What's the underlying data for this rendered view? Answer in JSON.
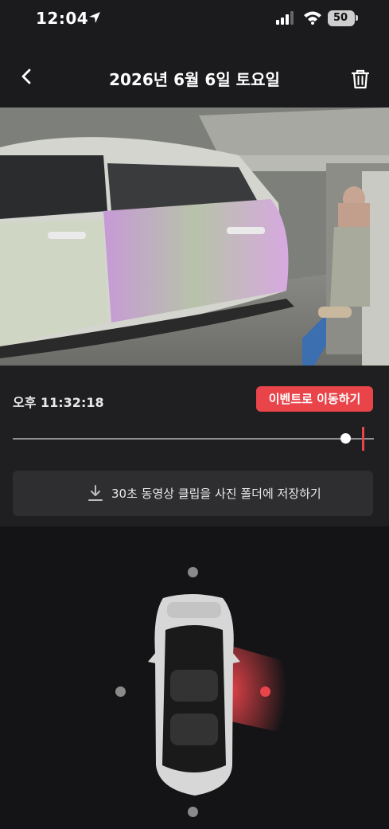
{
  "status_bar": {
    "time": "12:04",
    "battery": "50",
    "icons": [
      "location-arrow-icon",
      "cellular-signal-icon",
      "wifi-icon",
      "battery-icon"
    ]
  },
  "nav": {
    "title": "2026년 6월 6일 토요일",
    "back_icon": "chevron-left-icon",
    "trash_icon": "trash-icon"
  },
  "player": {
    "timestamp": "오후 11:32:18",
    "event_button": "이벤트로 이동하기",
    "scrubber_progress": 0.92,
    "event_marker_position": 0.97,
    "save_button": "30초 동영상 클립을 사진 폴더에 저장하기",
    "save_icon": "download-icon"
  },
  "camera_view": {
    "active_camera": "right-repeater",
    "cameras": [
      "front",
      "left",
      "right",
      "rear"
    ],
    "accent_color": "#e8444a"
  },
  "colors": {
    "background": "#1b1b1d",
    "accent": "#e8444a",
    "button_bg": "#2e2e30"
  }
}
